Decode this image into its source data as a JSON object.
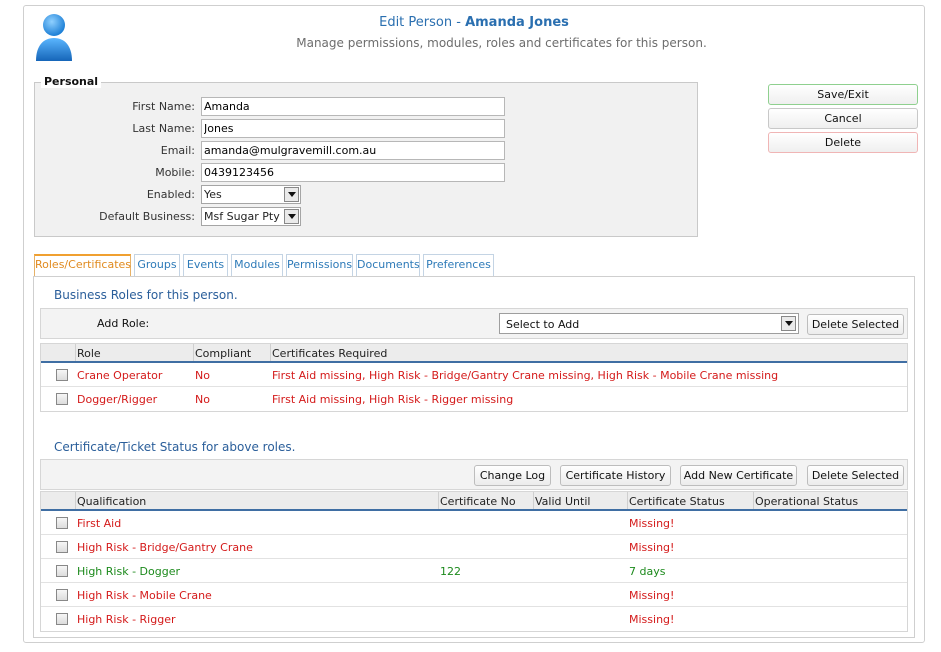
{
  "header": {
    "title_prefix": "Edit Person - ",
    "person_name": "Amanda Jones",
    "subtitle": "Manage permissions, modules, roles and certificates for this person."
  },
  "personal": {
    "legend": "Personal",
    "fields": {
      "first_name": {
        "label": "First Name:",
        "value": "Amanda"
      },
      "last_name": {
        "label": "Last Name:",
        "value": "Jones"
      },
      "email": {
        "label": "Email:",
        "value": "amanda@mulgravemill.com.au"
      },
      "mobile": {
        "label": "Mobile:",
        "value": "0439123456"
      },
      "enabled": {
        "label": "Enabled:",
        "value": "Yes"
      },
      "default_business": {
        "label": "Default Business:",
        "value": "Msf Sugar Pty Ltd"
      }
    }
  },
  "actions": {
    "save_exit": "Save/Exit",
    "cancel": "Cancel",
    "delete": "Delete"
  },
  "tabs": [
    {
      "label": "Roles/Certificates",
      "active": true
    },
    {
      "label": "Groups"
    },
    {
      "label": "Events"
    },
    {
      "label": "Modules"
    },
    {
      "label": "Permissions"
    },
    {
      "label": "Documents"
    },
    {
      "label": "Preferences"
    }
  ],
  "roles": {
    "title": "Business Roles for this person.",
    "add_role_label": "Add Role:",
    "add_role_select": "Select to Add",
    "delete_selected": "Delete Selected",
    "columns": {
      "role": "Role",
      "compliant": "Compliant",
      "certs": "Certificates Required"
    },
    "rows": [
      {
        "role": "Crane Operator",
        "compliant": "No",
        "certs": "First Aid missing, High Risk - Bridge/Gantry Crane missing, High Risk - Mobile Crane missing"
      },
      {
        "role": "Dogger/Rigger",
        "compliant": "No",
        "certs": "First Aid missing, High Risk - Rigger missing"
      }
    ]
  },
  "certificates": {
    "title": "Certificate/Ticket Status for above roles.",
    "buttons": {
      "change_log": "Change Log",
      "history": "Certificate History",
      "add_new": "Add New Certificate",
      "delete_selected": "Delete Selected"
    },
    "columns": {
      "qualification": "Qualification",
      "cert_no": "Certificate No",
      "valid_until": "Valid Until",
      "status": "Certificate Status",
      "operational": "Operational Status"
    },
    "rows": [
      {
        "qualification": "First Aid",
        "cert_no": "",
        "valid_until": "",
        "status": "Missing!",
        "color": "#d41a1a"
      },
      {
        "qualification": "High Risk - Bridge/Gantry Crane",
        "cert_no": "",
        "valid_until": "",
        "status": "Missing!",
        "color": "#d41a1a"
      },
      {
        "qualification": "High Risk - Dogger",
        "cert_no": "122",
        "valid_until": "",
        "status": "7 days",
        "color": "#1c8a1c"
      },
      {
        "qualification": "High Risk - Mobile Crane",
        "cert_no": "",
        "valid_until": "",
        "status": "Missing!",
        "color": "#d41a1a"
      },
      {
        "qualification": "High Risk - Rigger",
        "cert_no": "",
        "valid_until": "",
        "status": "Missing!",
        "color": "#d41a1a"
      }
    ]
  },
  "colors": {
    "accent": "#2a6fb0",
    "active_tab": "#e08a1e",
    "error": "#d41a1a",
    "ok": "#1c8a1c"
  }
}
